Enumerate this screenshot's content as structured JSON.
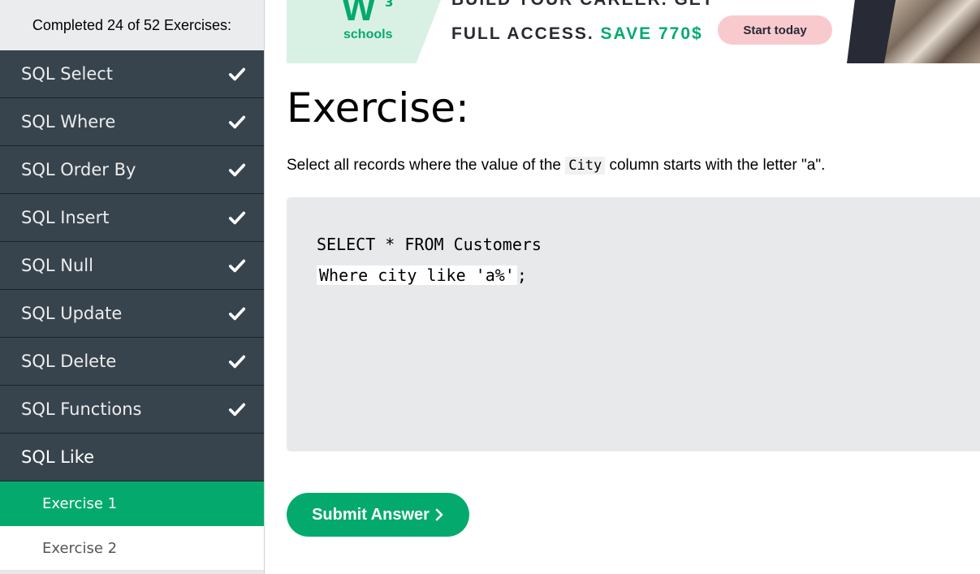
{
  "sidebar": {
    "progress": "Completed 24 of 52 Exercises:",
    "categories": [
      {
        "label": "SQL Select",
        "done": true
      },
      {
        "label": "SQL Where",
        "done": true
      },
      {
        "label": "SQL Order By",
        "done": true
      },
      {
        "label": "SQL Insert",
        "done": true
      },
      {
        "label": "SQL Null",
        "done": true
      },
      {
        "label": "SQL Update",
        "done": true
      },
      {
        "label": "SQL Delete",
        "done": true
      },
      {
        "label": "SQL Functions",
        "done": true
      },
      {
        "label": "SQL Like",
        "done": false
      }
    ],
    "subitems": [
      {
        "label": "Exercise 1",
        "active": true
      },
      {
        "label": "Exercise 2",
        "active": false
      }
    ]
  },
  "ad": {
    "logo_mark": "W",
    "logo_sup": "3",
    "logo_text": "schools",
    "line1": "BUILD YOUR CAREER. GET",
    "line2_prefix": "FULL ACCESS.",
    "line2_save": "SAVE 770$",
    "cta": "Start today"
  },
  "main": {
    "title": "Exercise:",
    "instruction_before": "Select all records where the value of the",
    "instruction_code": "City",
    "instruction_after": "column starts with the letter \"a\".",
    "code_line1": "SELECT * FROM Customers",
    "code_line2_answer": "Where city like 'a%'",
    "code_line2_end": ";",
    "submit_label": "Submit Answer"
  },
  "colors": {
    "accent": "#04aa6d",
    "sidebar_dark": "#38444d",
    "editor_bg": "#e7e9eb"
  }
}
